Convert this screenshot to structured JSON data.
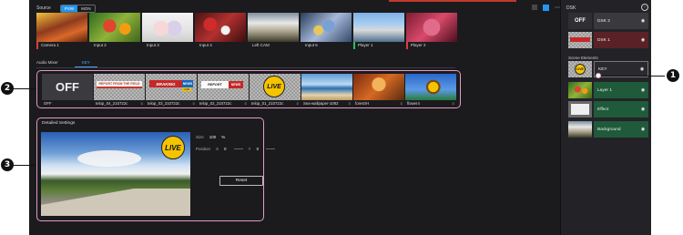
{
  "header": {
    "source_title": "Source",
    "pvw_label": "PVW",
    "mon_label": "MON",
    "icons": [
      "grid-icon",
      "square-icon",
      "more-icon",
      "collapse-icon"
    ]
  },
  "sources": [
    {
      "label": "Camera 1",
      "tally": "red"
    },
    {
      "label": "Input 2",
      "tally": "none"
    },
    {
      "label": "Input 3",
      "tally": "none"
    },
    {
      "label": "Input 4",
      "tally": "none"
    },
    {
      "label": "Left CAM",
      "tally": "none"
    },
    {
      "label": "Input 6",
      "tally": "none"
    },
    {
      "label": "Player 1",
      "tally": "green"
    },
    {
      "label": "Player 2",
      "tally": "red"
    }
  ],
  "tabs": [
    {
      "label": "Audio Mixer",
      "active": false
    },
    {
      "label": "KEY",
      "active": true
    }
  ],
  "dsk_items": [
    {
      "label": "OFF",
      "off_text": "OFF"
    },
    {
      "label": "telop_04_210722c",
      "banner": "REPORT FROM THE FIELD"
    },
    {
      "label": "telop_03_210722c",
      "banner": "BRAKING",
      "banner2": "NEWS",
      "banner3": "LIVE"
    },
    {
      "label": "telop_02_210722c",
      "banner": "REPORT",
      "banner2": "NEWS"
    },
    {
      "label": "telop_01_210722c",
      "banner": "LIVE"
    },
    {
      "label": "Sea-wallpaper-1082"
    },
    {
      "label": "forest!H"
    },
    {
      "label": "flower4"
    }
  ],
  "details": {
    "title": "Detailed Settings",
    "live_text": "LIVE",
    "size_label": "Size",
    "size_value": "100",
    "size_unit": "%",
    "position_label": "Position",
    "x_label": "X",
    "x_value": "0",
    "y_label": "Y",
    "y_value": "0",
    "reset_label": "Reset"
  },
  "right_panel": {
    "title": "DSK",
    "dsk2": {
      "thumb": "OFF",
      "label": "DSK 2"
    },
    "dsk1": {
      "label": "DSK 1"
    },
    "scene_elements_title": "Scene Elements",
    "elements": [
      {
        "label": "KEY",
        "thumb_text": "LIVE"
      },
      {
        "label": "Layer 1"
      },
      {
        "label": "Effect"
      },
      {
        "label": "Background"
      }
    ]
  },
  "callouts": [
    "1",
    "2",
    "3"
  ]
}
